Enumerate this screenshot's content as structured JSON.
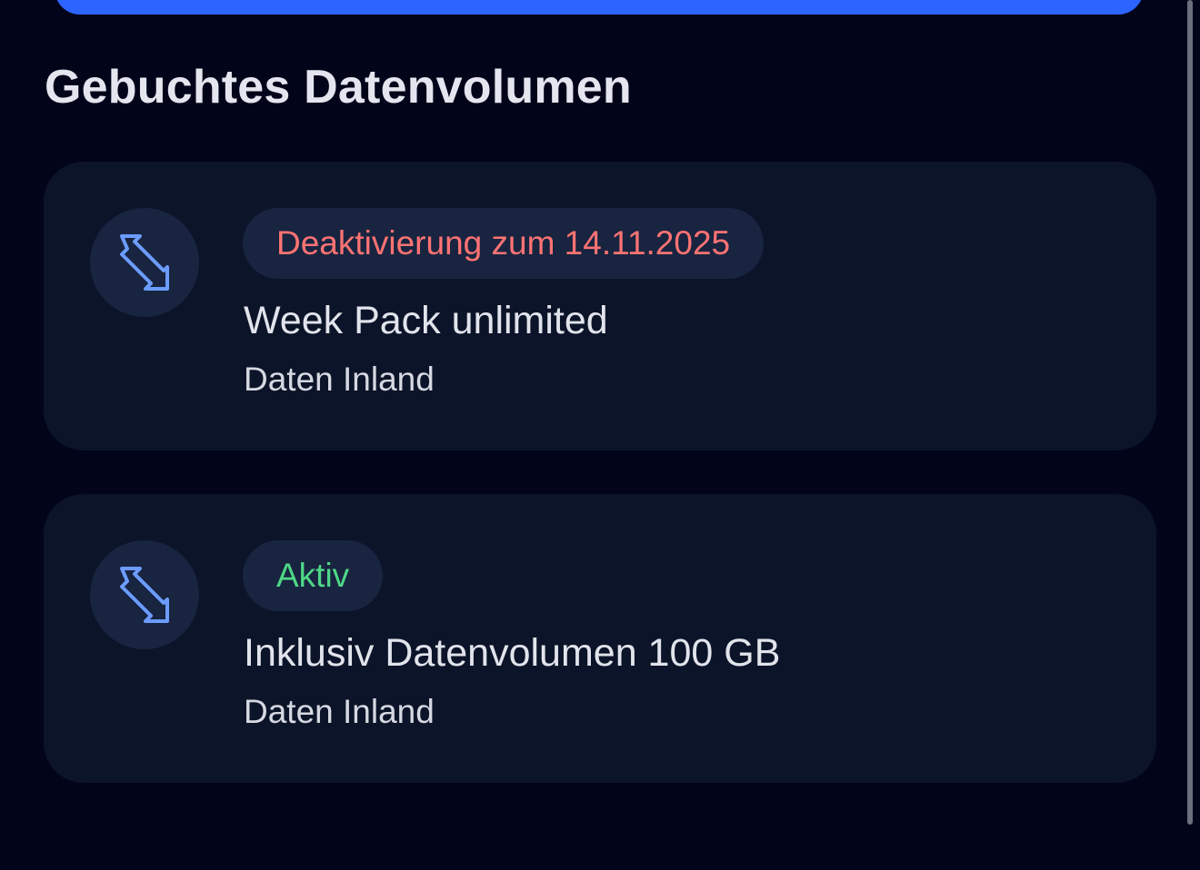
{
  "section_title": "Gebuchtes Datenvolumen",
  "colors": {
    "background": "#02041a",
    "card": "#0c1429",
    "primary_button": "#2d63ff",
    "status_deactivation": "#ff7373",
    "status_active": "#4fd787",
    "icon": "#6c9cff"
  },
  "packs": [
    {
      "status": "Deaktivierung zum 14.11.2025",
      "name": "Week Pack unlimited",
      "type": "Daten Inland",
      "icon": "data-transfer-icon"
    },
    {
      "status": "Aktiv",
      "name": "Inklusiv Datenvolumen 100 GB",
      "type": "Daten Inland",
      "icon": "data-transfer-icon"
    }
  ]
}
